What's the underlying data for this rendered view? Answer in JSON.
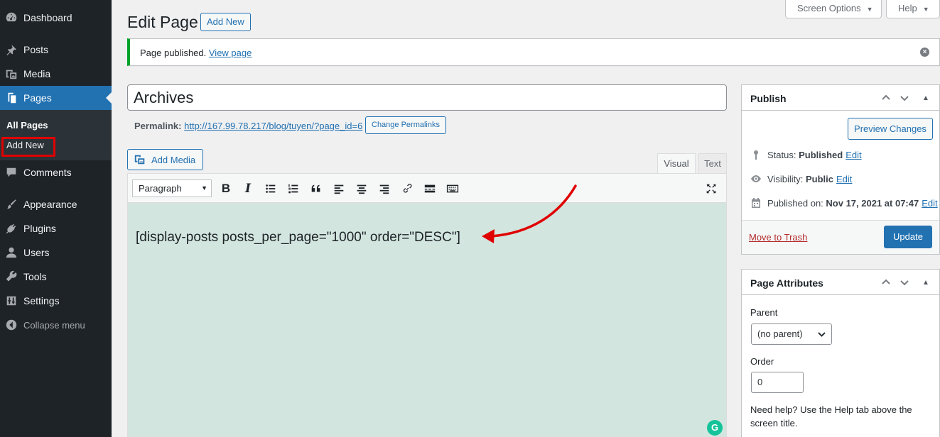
{
  "sidebar": {
    "items": [
      {
        "label": "Dashboard",
        "icon": "dashboard-icon"
      },
      {
        "label": "Posts",
        "icon": "pin-icon"
      },
      {
        "label": "Media",
        "icon": "media-icon"
      },
      {
        "label": "Pages",
        "icon": "pages-icon",
        "current": true
      },
      {
        "label": "Comments",
        "icon": "comment-icon"
      },
      {
        "label": "Appearance",
        "icon": "brush-icon"
      },
      {
        "label": "Plugins",
        "icon": "plugin-icon"
      },
      {
        "label": "Users",
        "icon": "user-icon"
      },
      {
        "label": "Tools",
        "icon": "wrench-icon"
      },
      {
        "label": "Settings",
        "icon": "settings-icon"
      }
    ],
    "submenu": {
      "all_pages": "All Pages",
      "add_new": "Add New"
    },
    "collapse": "Collapse menu"
  },
  "header": {
    "title": "Edit Page",
    "add_new": "Add New",
    "screen_options": "Screen Options",
    "help": "Help"
  },
  "notice": {
    "text": "Page published.",
    "link": "View page"
  },
  "post": {
    "title": "Archives",
    "permalink_label": "Permalink:",
    "permalink_url": "http://167.99.78.217/blog/tuyen/?page_id=6",
    "change_permalinks": "Change Permalinks"
  },
  "editor": {
    "add_media": "Add Media",
    "tab_visual": "Visual",
    "tab_text": "Text",
    "format": "Paragraph",
    "content": "[display-posts posts_per_page=\"1000\" order=\"DESC\"]"
  },
  "publish": {
    "title": "Publish",
    "preview": "Preview Changes",
    "status_label": "Status:",
    "status_value": "Published",
    "visibility_label": "Visibility:",
    "visibility_value": "Public",
    "published_label": "Published on:",
    "published_value": "Nov 17, 2021 at 07:47",
    "edit": "Edit",
    "trash": "Move to Trash",
    "update": "Update"
  },
  "attributes": {
    "title": "Page Attributes",
    "parent_label": "Parent",
    "parent_value": "(no parent)",
    "order_label": "Order",
    "order_value": "0",
    "help": "Need help? Use the Help tab above the screen title."
  },
  "colors": {
    "admin_bg": "#1d2327",
    "accent": "#2271b1",
    "notice_success": "#00a32a",
    "editor_bg": "#d3e5df",
    "annotation_red": "#e00000"
  }
}
